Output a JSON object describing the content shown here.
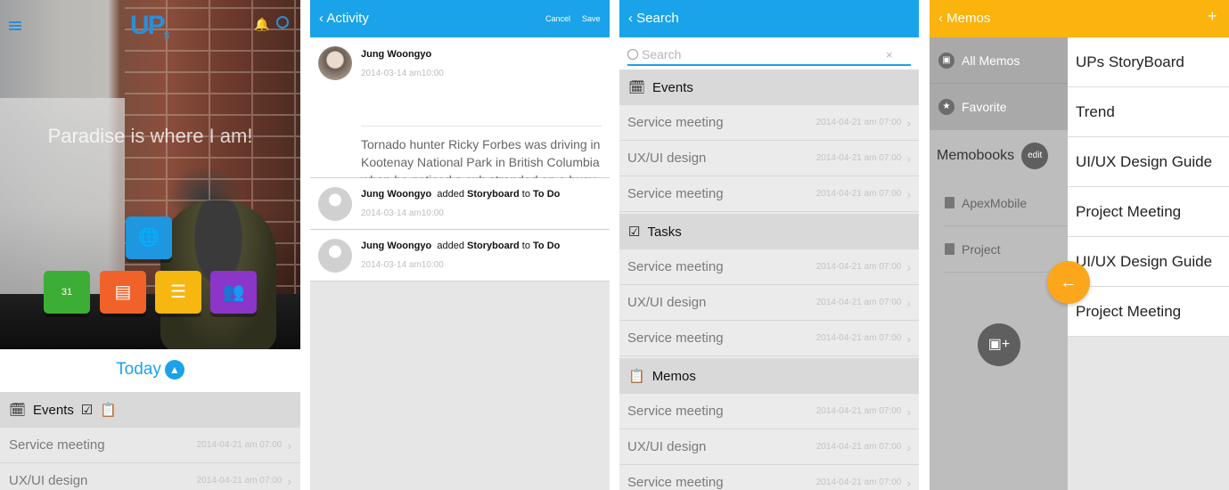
{
  "home": {
    "tagline": "Paradise is where I am!",
    "logo_text": "UP",
    "logo_sub": "S",
    "today_label": "Today",
    "events_label": "Events",
    "rows": [
      {
        "title": "Service meeting",
        "date": "2014-04-21 am 07:00"
      },
      {
        "title": "UX/UI design",
        "date": "2014-04-21 am 07:00"
      }
    ],
    "app_icons": [
      "globe-icon",
      "calendar-icon",
      "document-icon",
      "list-icon",
      "people-icon"
    ],
    "calendar_day": "31",
    "colors": {
      "globe": "#1e96e0",
      "calendar": "#3dae35",
      "document": "#f0622a",
      "list": "#f6b711",
      "people": "#8b35c9",
      "accent": "#1aa3e8"
    }
  },
  "activity": {
    "title": "Activity",
    "cancel": "Cancel",
    "save": "Save",
    "post": {
      "user": "Jung Woongyo",
      "time": "2014-03-14 am10:00",
      "body": "Tornado hunter Ricky Forbes was driving in Kootenay National Park in British Columbia when he noticed a cub stranded on a busy road."
    },
    "items": [
      {
        "user": "Jung Woongyo",
        "verb": "added",
        "object": "Storyboard",
        "prep": "to",
        "target": "To Do",
        "time": "2014-03-14 am10:00"
      },
      {
        "user": "Jung Woongyo",
        "verb": "added",
        "object": "Storyboard",
        "prep": "to",
        "target": "To Do",
        "time": "2014-03-14 am10:00"
      }
    ]
  },
  "search": {
    "title": "Search",
    "placeholder": "Search",
    "sections": [
      {
        "label": "Events",
        "rows": [
          {
            "title": "Service meeting",
            "date": "2014-04-21 am 07:00"
          },
          {
            "title": "UX/UI design",
            "date": "2014-04-21 am 07:00"
          },
          {
            "title": "Service meeting",
            "date": "2014-04-21 am 07:00"
          }
        ]
      },
      {
        "label": "Tasks",
        "rows": [
          {
            "title": "Service meeting",
            "date": "2014-04-21 am 07:00"
          },
          {
            "title": "UX/UI design",
            "date": "2014-04-21 am 07:00"
          },
          {
            "title": "Service meeting",
            "date": "2014-04-21 am 07:00"
          }
        ]
      },
      {
        "label": "Memos",
        "rows": [
          {
            "title": "Service meeting",
            "date": "2014-04-21 am 07:00"
          },
          {
            "title": "UX/UI design",
            "date": "2014-04-21 am 07:00"
          },
          {
            "title": "Service meeting",
            "date": "2014-04-21 am 07:00"
          }
        ]
      }
    ]
  },
  "memos": {
    "title": "Memos",
    "nav": [
      {
        "label": "All Memos",
        "icon": "memo-icon"
      },
      {
        "label": "Favorite",
        "icon": "star-icon"
      }
    ],
    "memobooks_label": "Memobooks",
    "edit_label": "edit",
    "books": [
      "ApexMobile",
      "Project"
    ],
    "list": [
      "UPs StoryBoard",
      "Trend",
      "UI/UX Design Guide",
      "Project Meeting",
      "UI/UX Design Guide",
      "Project Meeting"
    ],
    "colors": {
      "header": "#fbb30d",
      "fab": "#fba61b"
    }
  }
}
